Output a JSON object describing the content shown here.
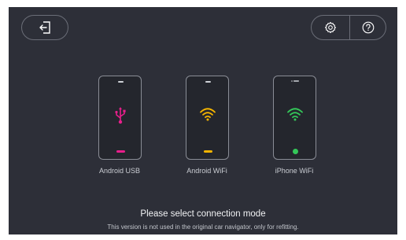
{
  "header": {
    "back_icon": "exit-icon",
    "settings_icon": "gear-icon",
    "help_icon": "help-icon"
  },
  "modes": [
    {
      "label": "Android USB",
      "icon": "usb-icon",
      "color": "#e91e8c"
    },
    {
      "label": "Android WiFi",
      "icon": "wifi-icon",
      "color": "#f4b400"
    },
    {
      "label": "iPhone WiFi",
      "icon": "wifi-icon",
      "color": "#34c759"
    }
  ],
  "footer": {
    "title": "Please select connection mode",
    "note": "This version is not used in the original car navigator, only for refitting."
  },
  "colors": {
    "background": "#2d2f38",
    "outline": "#6b6e78"
  }
}
